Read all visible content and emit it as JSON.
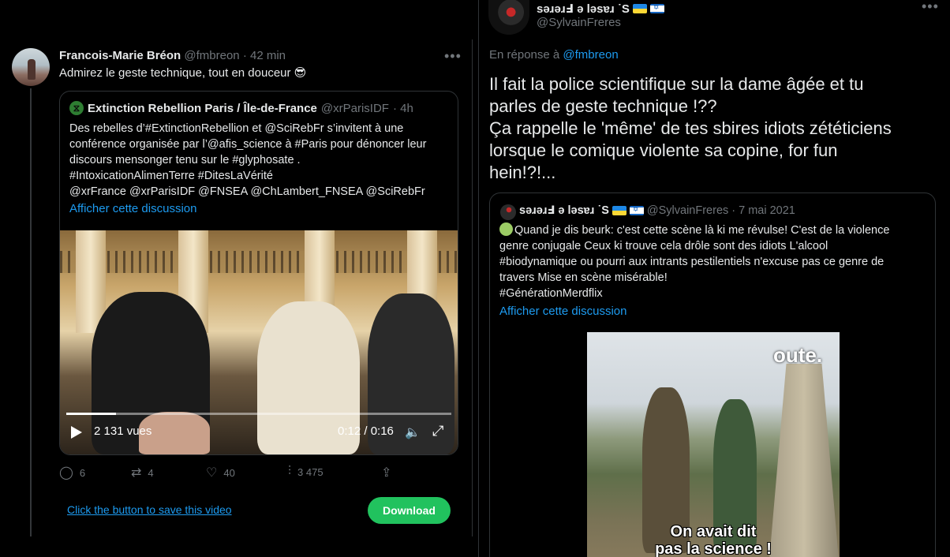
{
  "left_tweet": {
    "author_name": "Francois-Marie Bréon",
    "author_handle": "@fmbreon",
    "time": "· 42 min",
    "text": "Admirez le geste technique, tout en douceur 😎",
    "more_icon": "more-horizontal-icon",
    "quote": {
      "author_name": "Extinction Rebellion Paris / Île-de-France",
      "author_handle": "@xrParisIDF",
      "time": "· 4h",
      "lines": [
        "Des rebelles d’#ExtinctionRebellion et @SciRebFr s’invitent à une",
        "conférence organisée par l’@afis_science à #Paris pour dénoncer leur",
        "discours mensonger tenu sur le #glyphosate .",
        "#IntoxicationAlimenTerre #DitesLaVérité",
        "@xrFrance @xrParisIDF @FNSEA @ChLambert_FNSEA @SciRebFr"
      ],
      "show_thread": "Afficher cette discussion",
      "video": {
        "views": "2 131 vues",
        "time": "0:12 / 0:16",
        "progress": 0.13
      }
    },
    "actions": {
      "replies": "6",
      "retweets": "4",
      "likes": "40",
      "views": "3 475"
    },
    "save_link": "Click the button to save this video",
    "download": "Download"
  },
  "right_tweet": {
    "author_name": "sǝɹǝɹℲ ǝ lǝsɐɹ ˙S",
    "author_handle": "@SylvainFreres",
    "more_icon": "more-horizontal-icon",
    "reply_prefix": "En réponse à",
    "reply_to": "@fmbreon",
    "lines": [
      "Il fait la police scientifique sur la dame âgée et tu",
      "parles de geste technique !??",
      "Ça rappelle le 'même' de tes sbires idiots zététiciens",
      "lorsque le comique violente sa copine, for fun",
      "hein!?!..."
    ],
    "quote": {
      "author_name": "sǝɹǝɹℲ ǝ lǝsɐɹ ˙S",
      "author_handle": "@SylvainFreres",
      "time": "· 7 mai 2021",
      "lines": [
        "Quand je dis beurk: c'est cette scène là ki me révulse! C'est de la violence",
        "genre conjugale Ceux ki trouve cela drôle sont des idiots L'alcool",
        "#biodynamique ou pourri aux intrants pestilentiels n'excuse pas ce genre de",
        "travers Mise en scène misérable!",
        "#GénérationMerdflix"
      ],
      "show_thread": "Afficher cette discussion",
      "video": {
        "overlay_top": "oute.",
        "subtitle_1": "On avait dit",
        "subtitle_2": "pas la science !"
      }
    }
  },
  "colors": {
    "background": "#000000",
    "text": "#e7e9ea",
    "muted": "#71767b",
    "link": "#1d9bf0",
    "border": "#2f3336",
    "download": "#21c25e"
  }
}
